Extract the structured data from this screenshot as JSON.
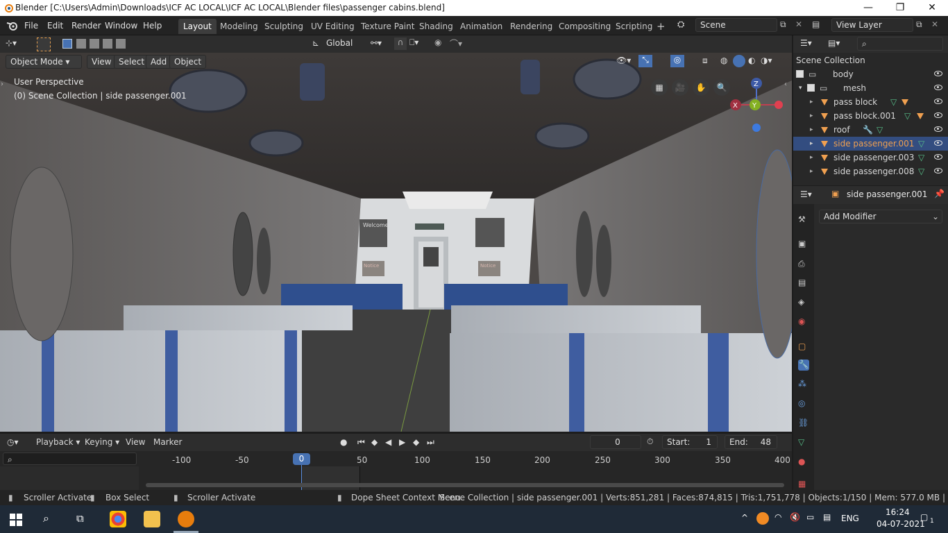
{
  "window": {
    "title": "Blender [C:\\Users\\Admin\\Downloads\\ICF AC LOCAL\\ICF AC LOCAL\\Blender files\\passenger cabins.blend]",
    "minimize": "—",
    "restore": "❐",
    "close": "✕"
  },
  "menus": [
    "File",
    "Edit",
    "Render",
    "Window",
    "Help"
  ],
  "workspaces": [
    "Layout",
    "Modeling",
    "Sculpting",
    "UV Editing",
    "Texture Paint",
    "Shading",
    "Animation",
    "Rendering",
    "Compositing",
    "Scripting"
  ],
  "workspace_add": "+",
  "scene": {
    "name": "Scene"
  },
  "view_layer": {
    "name": "View Layer"
  },
  "viewport": {
    "transform_orientation": "Global",
    "mode": "Object Mode",
    "header_menus": [
      "View",
      "Select",
      "Add",
      "Object"
    ],
    "perspective": "User Perspective",
    "context": "(0) Scene Collection | side passenger.001",
    "gizmo": {
      "z": "Z",
      "y": "Y",
      "x": "X"
    },
    "scene_signs": {
      "welcome": "Welcome",
      "notice1": "Notice",
      "notice2": "Notice"
    }
  },
  "outliner": {
    "title": "Scene Collection",
    "items": [
      {
        "label": "body",
        "type": "collection"
      },
      {
        "label": "mesh",
        "type": "collection"
      },
      {
        "label": "pass block",
        "type": "object"
      },
      {
        "label": "pass block.001",
        "type": "object"
      },
      {
        "label": "roof",
        "type": "object"
      },
      {
        "label": "side passenger.001",
        "type": "object",
        "selected": true
      },
      {
        "label": "side passenger.003",
        "type": "object"
      },
      {
        "label": "side passenger.008",
        "type": "object"
      }
    ]
  },
  "properties": {
    "object_name": "side passenger.001",
    "add_modifier": "Add Modifier"
  },
  "timeline": {
    "menus": [
      "Playback",
      "Keying",
      "View",
      "Marker"
    ],
    "current_frame": "0",
    "start_label": "Start:",
    "start": "1",
    "end_label": "End:",
    "end": "48",
    "ticks": [
      "-100",
      "-50",
      "0",
      "50",
      "100",
      "150",
      "200",
      "250",
      "300",
      "350",
      "400"
    ],
    "playhead": "0"
  },
  "statusbar": {
    "left1": "Scroller Activate",
    "left2": "Box Select",
    "left3": "Scroller Activate",
    "mid": "Dope Sheet Context Menu",
    "right": "Scene Collection | side passenger.001 | Verts:851,281 | Faces:874,815 | Tris:1,751,778 | Objects:1/150 | Mem: 577.0 MB |"
  },
  "taskbar": {
    "time": "16:24",
    "date": "04-07-2021",
    "lang": "ENG",
    "notif": "1"
  }
}
